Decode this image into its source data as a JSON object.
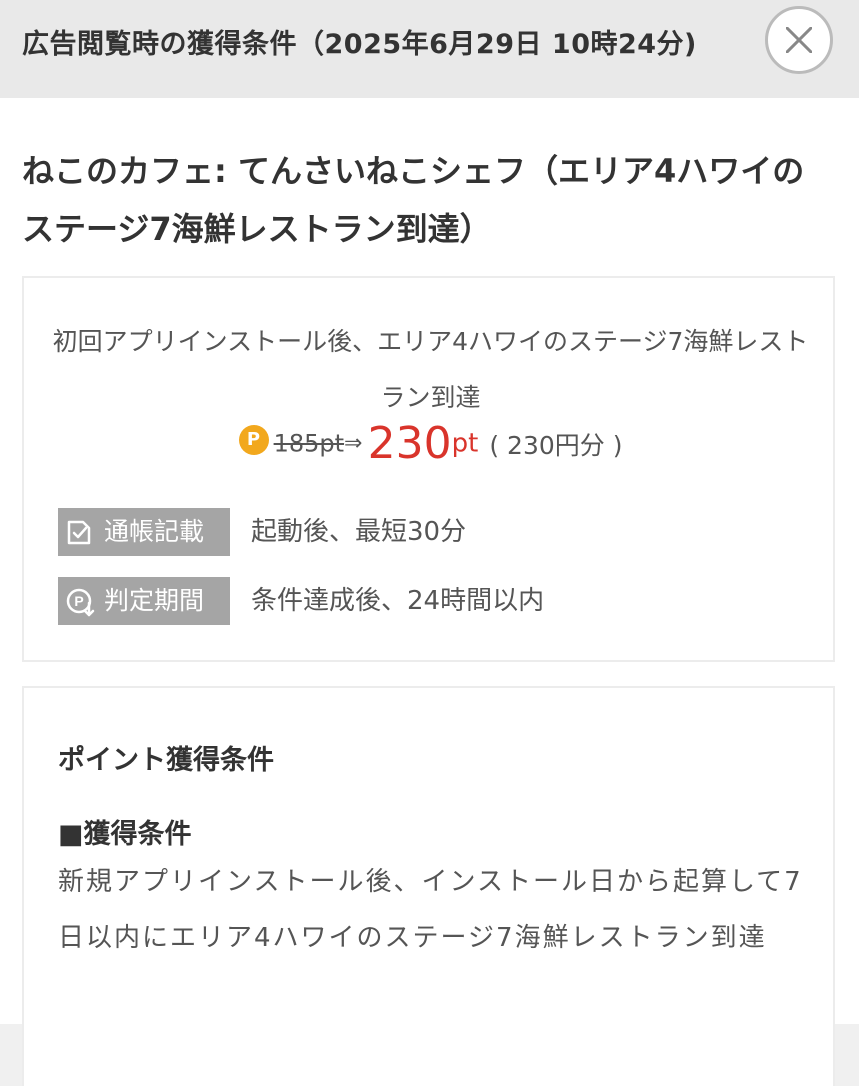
{
  "header": {
    "title": "広告閲覧時の獲得条件（2025年6月29日 10時24分)"
  },
  "main": {
    "title": "ねこのカフェ: てんさいねこシェフ（エリア4ハワイのステージ7海鮮レストラン到達）"
  },
  "offer": {
    "description": "初回アプリインストール後、エリア4ハワイのステージ7海鮮レストラン到達",
    "point_icon": "P",
    "old_points": "185pt",
    "arrow": "⇒",
    "new_points": "230",
    "new_unit": "pt",
    "yen_value": "( 230円分 )",
    "rows": [
      {
        "badge": "通帳記載",
        "icon": "checklist-icon",
        "text": "起動後、最短30分"
      },
      {
        "badge": "判定期間",
        "icon": "point-download-icon",
        "text": "条件達成後、24時間以内"
      }
    ]
  },
  "conditions": {
    "section_title": "ポイント獲得条件",
    "subtitle": "■獲得条件",
    "text": "新規アプリインストール後、インストール日から起算して7日以内にエリア4ハワイのステージ7海鮮レストラン到達"
  },
  "colors": {
    "header_bg": "#e9e9e9",
    "point_red": "#d9342b",
    "point_icon_orange": "#f2a81d",
    "badge_gray": "#a5a5a5"
  }
}
